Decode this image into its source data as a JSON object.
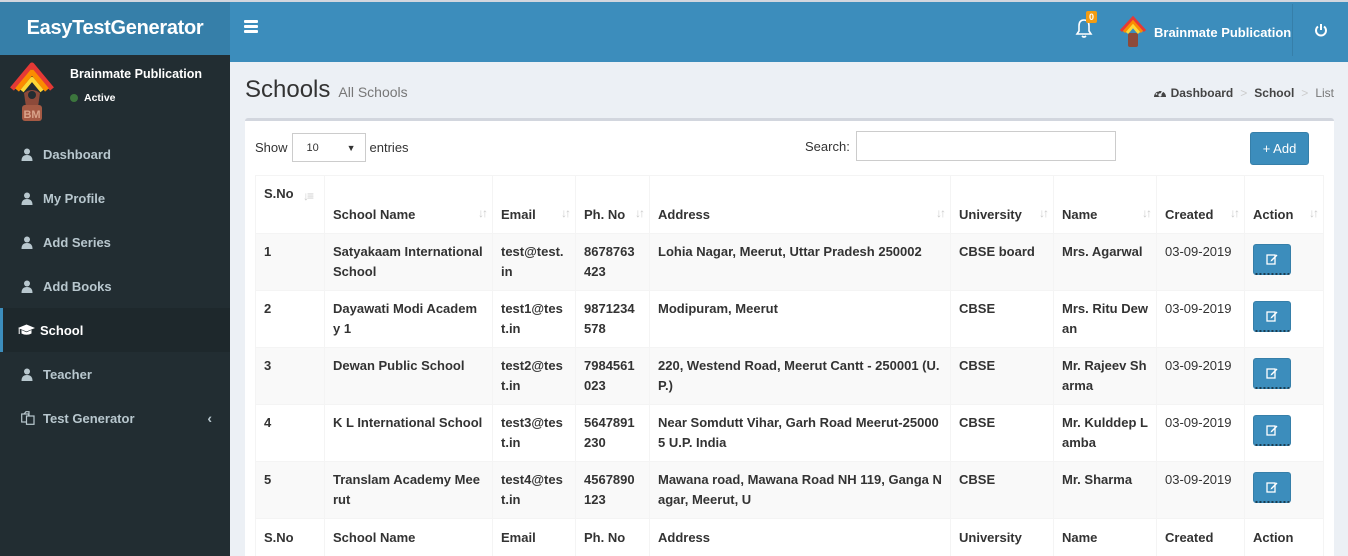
{
  "app": {
    "title": "EasyTestGenerator"
  },
  "topbar": {
    "notifications_count": "0",
    "user_name": "Brainmate Publication"
  },
  "sidebar": {
    "user": {
      "name": "Brainmate Publication",
      "status": "Active"
    },
    "items": [
      {
        "label": "Dashboard",
        "icon": "user-icon"
      },
      {
        "label": "My Profile",
        "icon": "user-icon"
      },
      {
        "label": "Add Series",
        "icon": "user-icon"
      },
      {
        "label": "Add Books",
        "icon": "user-icon"
      },
      {
        "label": "School",
        "icon": "graduation-cap-icon",
        "active": true
      },
      {
        "label": "Teacher",
        "icon": "user-icon"
      },
      {
        "label": "Test Generator",
        "icon": "copy-icon",
        "has_submenu": true
      }
    ]
  },
  "page": {
    "title": "Schools",
    "subtitle": "All Schools",
    "breadcrumb": [
      "Dashboard",
      "School",
      "List"
    ]
  },
  "table_controls": {
    "show_label": "Show",
    "entries_value": "10",
    "entries_label": "entries",
    "search_label": "Search:",
    "search_value": "",
    "add_label": "+ Add"
  },
  "table": {
    "headers": [
      "S.No",
      "School Name",
      "Email",
      "Ph. No",
      "Address",
      "University",
      "Name",
      "Created",
      "Action"
    ],
    "rows": [
      {
        "sno": "1",
        "school": "Satyakaam International School",
        "email": "test@test.in",
        "phone": "8678763423",
        "address": "Lohia Nagar, Meerut, Uttar Pradesh 250002",
        "university": "CBSE board",
        "name": "Mrs. Agarwal",
        "created": "03-09-2019"
      },
      {
        "sno": "2",
        "school": "Dayawati Modi Academy 1",
        "email": "test1@test.in",
        "phone": "9871234578",
        "address": "Modipuram, Meerut",
        "university": "CBSE",
        "name": "Mrs. Ritu Dewan",
        "created": "03-09-2019"
      },
      {
        "sno": "3",
        "school": "Dewan Public School",
        "email": "test2@test.in",
        "phone": "7984561023",
        "address": "220, Westend Road, Meerut Cantt - 250001 (U.P.)",
        "university": "CBSE",
        "name": "Mr. Rajeev Sharma",
        "created": "03-09-2019"
      },
      {
        "sno": "4",
        "school": "K L International School",
        "email": "test3@test.in",
        "phone": "5647891230",
        "address": "Near Somdutt Vihar, Garh Road Meerut-250005 U.P. India",
        "university": "CBSE",
        "name": "Mr. Kulddep Lamba",
        "created": "03-09-2019"
      },
      {
        "sno": "5",
        "school": "Translam Academy Meerut",
        "email": "test4@test.in",
        "phone": "4567890123",
        "address": "Mawana road, Mawana Road NH 119, Ganga Nagar, Meerut, U",
        "university": "CBSE",
        "name": "Mr. Sharma",
        "created": "03-09-2019"
      }
    ]
  },
  "colors": {
    "primary": "#3c8dbc",
    "primary_dark": "#367fa9",
    "sidebar_bg": "#222d32",
    "badge": "#f39c12",
    "status_active": "#3c763d"
  }
}
